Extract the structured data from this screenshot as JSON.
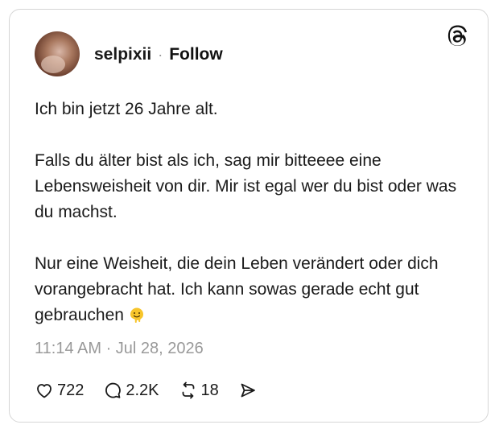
{
  "post": {
    "username": "selpixii",
    "separator": "·",
    "follow_label": "Follow",
    "paragraphs": [
      "Ich bin jetzt 26 Jahre alt.",
      "Falls du älter bist als ich, sag mir bitteeee eine Lebensweisheit von dir. Mir ist egal wer du bist oder was du machst.",
      "Nur eine Weisheit, die dein Leben verändert oder dich vorangebracht hat. Ich kann sowas gerade echt gut gebrauchen"
    ],
    "trailing_emoji": "melting-face-emoji",
    "timestamp": "11:14 AM · Jul 28, 2026"
  },
  "actions": {
    "likes": "722",
    "replies": "2.2K",
    "reposts": "18"
  },
  "icons": {
    "logo": "threads-logo-icon",
    "like": "heart-icon",
    "reply": "comment-icon",
    "repost": "repost-icon",
    "share": "send-icon"
  },
  "colors": {
    "text": "#1a1a1a",
    "muted": "#999999",
    "border": "#d6d6d6",
    "emoji": "#f7c52b"
  }
}
